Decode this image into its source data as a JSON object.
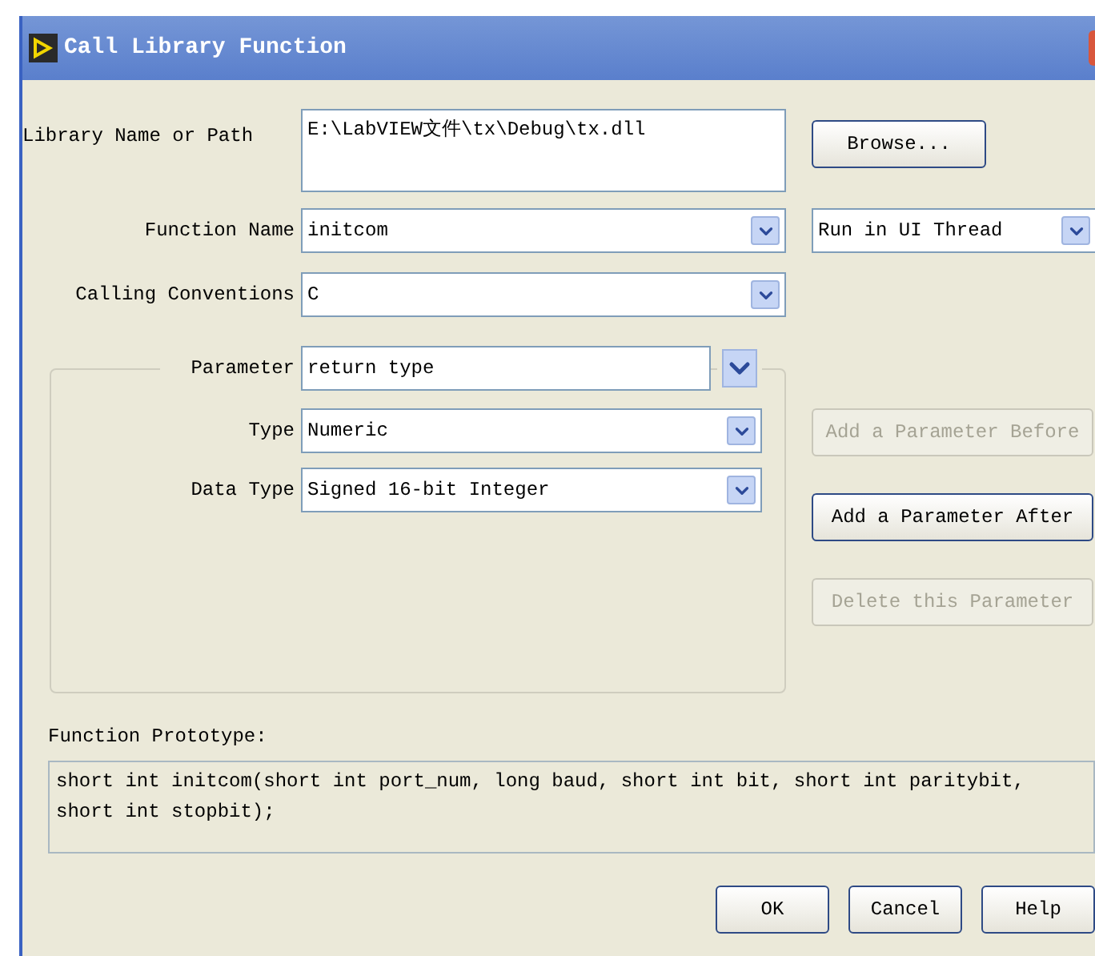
{
  "window": {
    "title": "Call Library Function"
  },
  "library_path": {
    "label": "Library Name or Path",
    "value": "E:\\LabVIEW文件\\tx\\Debug\\tx.dll"
  },
  "browse_button": "Browse...",
  "function_name": {
    "label": "Function Name",
    "value": "initcom"
  },
  "thread": {
    "value": "Run in UI Thread"
  },
  "calling_conventions": {
    "label": "Calling Conventions",
    "value": "C"
  },
  "parameter": {
    "label": "Parameter",
    "value": "return type"
  },
  "type": {
    "label": "Type",
    "value": "Numeric"
  },
  "data_type": {
    "label": "Data Type",
    "value": "Signed 16-bit Integer"
  },
  "side_buttons": [
    {
      "label": "Add a Parameter Before",
      "disabled": true
    },
    {
      "label": "Add a Parameter After",
      "disabled": false
    },
    {
      "label": "Delete this Parameter",
      "disabled": true
    }
  ],
  "prototype": {
    "label": "Function Prototype:",
    "value": "short int initcom(short int port_num, long baud, short int bit, short int paritybit, short int stopbit);"
  },
  "buttons": [
    "OK",
    "Cancel",
    "Help"
  ]
}
